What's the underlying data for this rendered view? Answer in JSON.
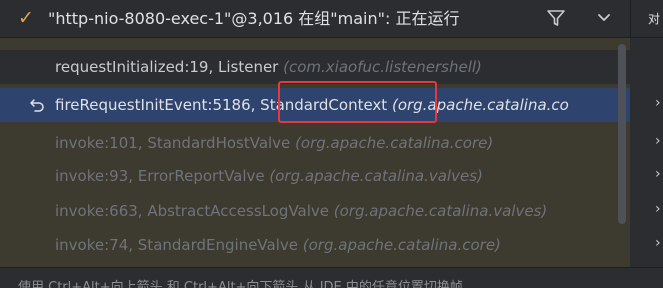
{
  "header": {
    "check_glyph": "✓",
    "thread_title": "\"http-nio-8080-exec-1\"@3,016 在组\"main\": 正在运行",
    "filter_icon": "filter-icon",
    "chevron_icon": "chevron-down-icon",
    "right_cut_text": "对"
  },
  "frames": [
    {
      "method": "requestInitialized:19, Listener",
      "pkg": "(com.xiaofuc.listenershell)"
    },
    {
      "method": "fireRequestInitEvent:5186, ",
      "highlight": "StandardContext",
      "pkg": "(org.apache.catalina.co"
    },
    {
      "method": "invoke:101, StandardHostValve ",
      "pkg": "(org.apache.catalina.core)"
    },
    {
      "method": "invoke:93, ErrorReportValve ",
      "pkg": "(org.apache.catalina.valves)"
    },
    {
      "method": "invoke:663, AbstractAccessLogValve ",
      "pkg": "(org.apache.catalina.valves)"
    },
    {
      "method": "invoke:74, StandardEngineValve ",
      "pkg": "(org.apache.catalina.core)"
    }
  ],
  "selected_icon": "return-arrow-icon",
  "hint": {
    "text": "使用 Ctrl+Alt+向上箭头 和 Ctrl+Alt+向下箭头 从 IDE 中的任意位置切换帧"
  },
  "colors": {
    "selection": "#2e436e",
    "highlight_border": "#e5393f",
    "accent": "#e0a35a"
  }
}
